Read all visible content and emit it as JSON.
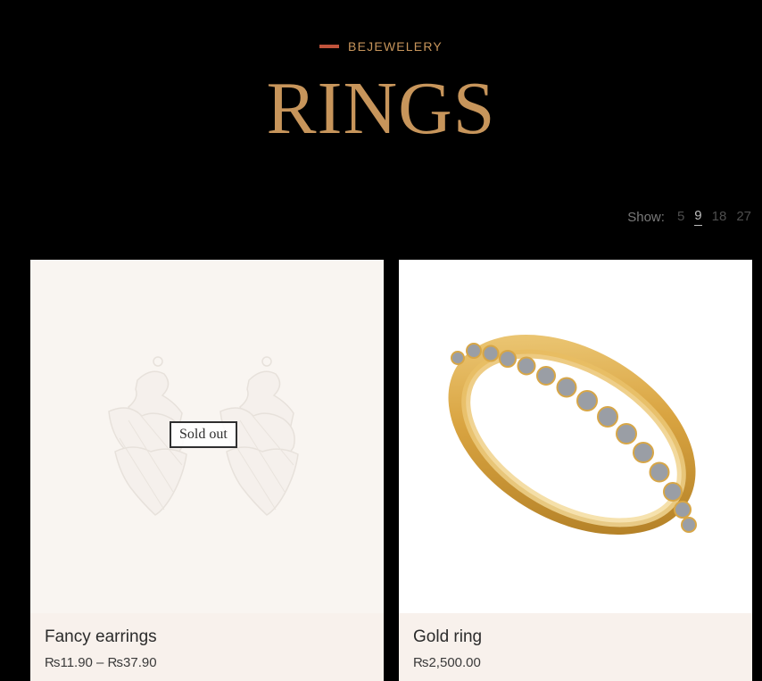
{
  "header": {
    "eyebrow": "BEJEWELERY",
    "title": "RINGS"
  },
  "show": {
    "label": "Show:",
    "options": [
      "5",
      "9",
      "18",
      "27"
    ],
    "selected": "9"
  },
  "products": [
    {
      "title": "Fancy earrings",
      "price": "₨11.90 – ₨37.90",
      "badge": "Sold out",
      "image": "earrings-image"
    },
    {
      "title": "Gold ring",
      "price": "₨2,500.00",
      "image": "gold-ring-image"
    }
  ],
  "colors": {
    "background": "#000000",
    "accent_gold": "#c7955b",
    "accent_red": "#c0533b",
    "card_info_bg": "#f8f1ec"
  }
}
